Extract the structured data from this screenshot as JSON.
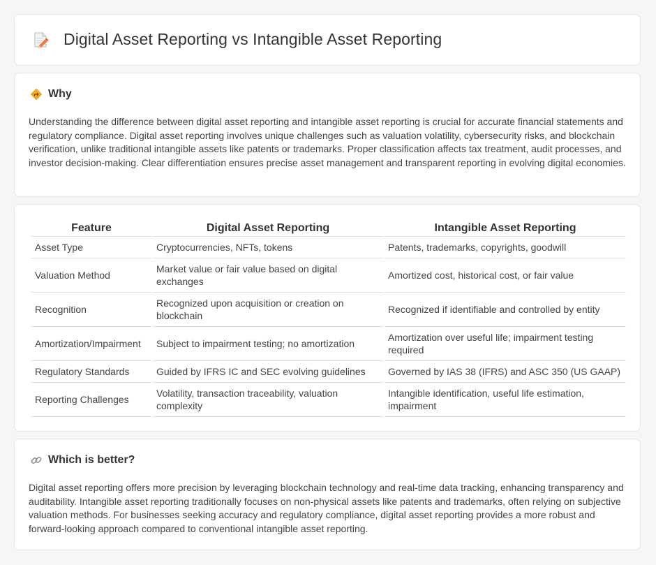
{
  "header": {
    "title": "Digital Asset Reporting vs Intangible Asset Reporting",
    "icon": "document-pencil-icon"
  },
  "why": {
    "heading": "Why",
    "icon": "diamond-sign-icon",
    "text": "Understanding the difference between digital asset reporting and intangible asset reporting is crucial for accurate financial statements and regulatory compliance. Digital asset reporting involves unique challenges such as valuation volatility, cybersecurity risks, and blockchain verification, unlike traditional intangible assets like patents or trademarks. Proper classification affects tax treatment, audit processes, and investor decision-making. Clear differentiation ensures precise asset management and transparent reporting in evolving digital economies."
  },
  "comparison": {
    "headers": [
      "Feature",
      "Digital Asset Reporting",
      "Intangible Asset Reporting"
    ],
    "rows": [
      [
        "Asset Type",
        "Cryptocurrencies, NFTs, tokens",
        "Patents, trademarks, copyrights, goodwill"
      ],
      [
        "Valuation Method",
        "Market value or fair value based on digital exchanges",
        "Amortized cost, historical cost, or fair value"
      ],
      [
        "Recognition",
        "Recognized upon acquisition or creation on blockchain",
        "Recognized if identifiable and controlled by entity"
      ],
      [
        "Amortization/Impairment",
        "Subject to impairment testing; no amortization",
        "Amortization over useful life; impairment testing required"
      ],
      [
        "Regulatory Standards",
        "Guided by IFRS IC and SEC evolving guidelines",
        "Governed by IAS 38 (IFRS) and ASC 350 (US GAAP)"
      ],
      [
        "Reporting Challenges",
        "Volatility, transaction traceability, valuation complexity",
        "Intangible identification, useful life estimation, impairment"
      ]
    ]
  },
  "better": {
    "heading": "Which is better?",
    "icon": "link-icon",
    "text": "Digital asset reporting offers more precision by leveraging blockchain technology and real-time data tracking, enhancing transparency and auditability. Intangible asset reporting traditionally focuses on non-physical assets like patents and trademarks, often relying on subjective valuation methods. For businesses seeking accuracy and regulatory compliance, digital asset reporting provides a more robust and forward-looking approach compared to conventional intangible asset reporting."
  }
}
